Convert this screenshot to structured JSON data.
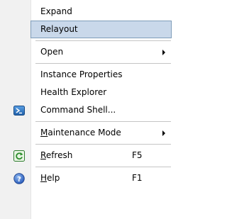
{
  "menu": {
    "items": [
      {
        "label": "Expand"
      },
      {
        "label": "Relayout"
      },
      {
        "label": "Open"
      },
      {
        "label": "Instance Properties"
      },
      {
        "label": "Health Explorer"
      },
      {
        "label": "Command Shell..."
      },
      {
        "mnemonic": "M",
        "rest": "aintenance Mode"
      },
      {
        "mnemonic": "R",
        "rest": "efresh",
        "shortcut": "F5"
      },
      {
        "mnemonic": "H",
        "rest": "elp",
        "shortcut": "F1"
      }
    ],
    "icons": {
      "command_shell": "powershell-icon",
      "refresh": "refresh-icon",
      "help": "help-icon"
    },
    "colors": {
      "highlight_fill": "#c9d8ea",
      "highlight_border": "#7f9db9",
      "gutter": "#f1f1f1"
    }
  }
}
